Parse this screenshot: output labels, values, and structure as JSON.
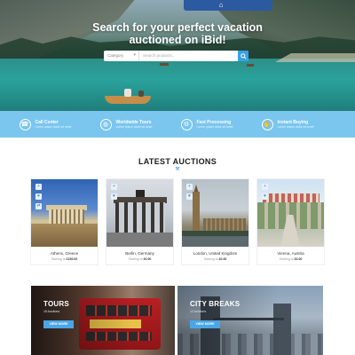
{
  "hero": {
    "title_line1": "Search for your perfect vacation",
    "title_line2": "auctioned on iBid!",
    "search": {
      "category_label": "Category",
      "placeholder": "Search products..."
    }
  },
  "features": [
    {
      "title": "Call Center",
      "subtitle": "Lorem ipsum dolor sit amet",
      "icon": "headset-icon"
    },
    {
      "title": "Worldwide Tours",
      "subtitle": "Lorem ipsum dolor sit amet",
      "icon": "globe-icon"
    },
    {
      "title": "Fast Processing",
      "subtitle": "Lorem ipsum dolor sit amet",
      "icon": "gear-icon"
    },
    {
      "title": "Instant Buying",
      "subtitle": "Lorem ipsum dolor sit amet",
      "icon": "hand-coin-icon"
    }
  ],
  "auctions": {
    "title": "LATEST AUCTIONS",
    "items": [
      {
        "name": "Athens, Greece",
        "price_label": "Starting at",
        "price": "£150.00"
      },
      {
        "name": "Berlin, Germany",
        "price_label": "Starting at",
        "price": "£0.00"
      },
      {
        "name": "London, United Kingdom",
        "price_label": "Starting at",
        "price": "£0.00"
      },
      {
        "name": "Vienna, Austria",
        "price_label": "Starting at",
        "price": "£0.00"
      }
    ]
  },
  "tiles": [
    {
      "title": "TOURS",
      "subtitle": "15 Auctions",
      "button": "VIEW MORE"
    },
    {
      "title": "CITY BREAKS",
      "subtitle": "12 Auctions",
      "button": "VIEW MORE"
    }
  ],
  "colors": {
    "accent": "#3aa0e4",
    "features_bg": "#7ac6ee",
    "nav_blue": "#2c5aa0"
  }
}
